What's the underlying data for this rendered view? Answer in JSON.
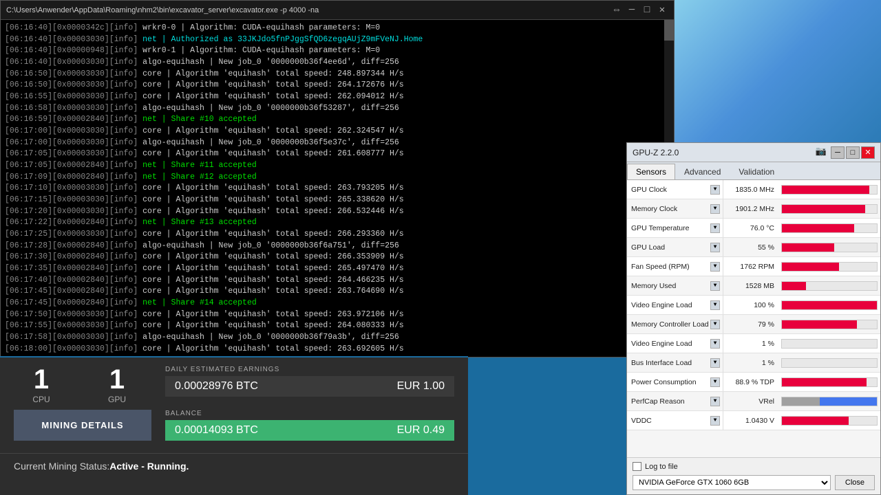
{
  "terminal": {
    "title": "C:\\Users\\Anwender\\AppData\\Roaming\\nhm2\\bin\\excavator_server\\excavator.exe  -p 4000 -na",
    "lines": [
      {
        "prefix": "[06:16:40][0x0000342c][info]",
        "text": " wrkr0-0 | Algorithm: CUDA-equihash parameters: M=0",
        "color": "normal"
      },
      {
        "prefix": "[06:16:40][0x00003030][info]",
        "text": " net | Authorized as 33JKJdo5fnPJggSfQD6zegqAUjZ9mFVeNJ.Home",
        "color": "cyan"
      },
      {
        "prefix": "[06:16:40][0x00000948][info]",
        "text": " wrkr0-1 | Algorithm: CUDA-equihash parameters: M=0",
        "color": "normal"
      },
      {
        "prefix": "[06:16:40][0x00003030][info]",
        "text": " algo-equihash | New job_0 '0000000b36f4ee6d', diff=256",
        "color": "normal"
      },
      {
        "prefix": "[06:16:50][0x00003030][info]",
        "text": " core | Algorithm 'equihash' total speed: 248.897344 H/s",
        "color": "normal"
      },
      {
        "prefix": "[06:16:50][0x00003030][info]",
        "text": " core | Algorithm 'equihash' total speed: 264.172676 H/s",
        "color": "normal"
      },
      {
        "prefix": "[06:16:55][0x00003030][info]",
        "text": " core | Algorithm 'equihash' total speed: 262.094012 H/s",
        "color": "normal"
      },
      {
        "prefix": "[06:16:58][0x00003030][info]",
        "text": " algo-equihash | New job_0 '0000000b36f53287', diff=256",
        "color": "normal"
      },
      {
        "prefix": "[06:16:59][0x00002840][info]",
        "text": " net | Share #10 accepted",
        "color": "green"
      },
      {
        "prefix": "[06:17:00][0x00003030][info]",
        "text": " core | Algorithm 'equihash' total speed: 262.324547 H/s",
        "color": "normal"
      },
      {
        "prefix": "[06:17:00][0x00003030][info]",
        "text": " algo-equihash | New job_0 '0000000b36f5e37c', diff=256",
        "color": "normal"
      },
      {
        "prefix": "[06:17:05][0x00003030][info]",
        "text": " core | Algorithm 'equihash' total speed: 261.608777 H/s",
        "color": "normal"
      },
      {
        "prefix": "[06:17:05][0x00002840][info]",
        "text": " net | Share #11 accepted",
        "color": "green"
      },
      {
        "prefix": "[06:17:09][0x00002840][info]",
        "text": " net | Share #12 accepted",
        "color": "green"
      },
      {
        "prefix": "[06:17:10][0x00003030][info]",
        "text": " core | Algorithm 'equihash' total speed: 263.793205 H/s",
        "color": "normal"
      },
      {
        "prefix": "[06:17:15][0x00003030][info]",
        "text": " core | Algorithm 'equihash' total speed: 265.338620 H/s",
        "color": "normal"
      },
      {
        "prefix": "[06:17:20][0x00003030][info]",
        "text": " core | Algorithm 'equihash' total speed: 266.532446 H/s",
        "color": "normal"
      },
      {
        "prefix": "[06:17:22][0x00002840][info]",
        "text": " net | Share #13 accepted",
        "color": "green"
      },
      {
        "prefix": "[06:17:25][0x00003030][info]",
        "text": " core | Algorithm 'equihash' total speed: 266.293360 H/s",
        "color": "normal"
      },
      {
        "prefix": "[06:17:28][0x00002840][info]",
        "text": " algo-equihash | New job_0 '0000000b36f6a751', diff=256",
        "color": "normal"
      },
      {
        "prefix": "[06:17:30][0x00002840][info]",
        "text": " core | Algorithm 'equihash' total speed: 266.353909 H/s",
        "color": "normal"
      },
      {
        "prefix": "[06:17:35][0x00002840][info]",
        "text": " core | Algorithm 'equihash' total speed: 265.497470 H/s",
        "color": "normal"
      },
      {
        "prefix": "[06:17:40][0x00002840][info]",
        "text": " core | Algorithm 'equihash' total speed: 264.466235 H/s",
        "color": "normal"
      },
      {
        "prefix": "[06:17:45][0x00002840][info]",
        "text": " core | Algorithm 'equihash' total speed: 263.764690 H/s",
        "color": "normal"
      },
      {
        "prefix": "[06:17:45][0x00002840][info]",
        "text": " net | Share #14 accepted",
        "color": "green"
      },
      {
        "prefix": "[06:17:50][0x00003030][info]",
        "text": " core | Algorithm 'equihash' total speed: 263.972106 H/s",
        "color": "normal"
      },
      {
        "prefix": "[06:17:55][0x00003030][info]",
        "text": " core | Algorithm 'equihash' total speed: 264.080333 H/s",
        "color": "normal"
      },
      {
        "prefix": "[06:17:58][0x00003030][info]",
        "text": " algo-equihash | New job_0 '0000000b36f79a3b', diff=256",
        "color": "normal"
      },
      {
        "prefix": "[06:18:00][0x00003030][info]",
        "text": " core | Algorithm 'equihash' total speed: 263.692605 H/s",
        "color": "normal"
      }
    ]
  },
  "mining": {
    "cpu_count": "1",
    "cpu_label": "CPU",
    "gpu_count": "1",
    "gpu_label": "GPU",
    "earnings_label": "DAILY ESTIMATED EARNINGS",
    "earnings_btc": "0.00028976 BTC",
    "earnings_eur": "EUR 1.00",
    "mining_details_btn": "MINING DETAILS",
    "balance_label": "BALANCE",
    "balance_btc": "0.00014093 BTC",
    "balance_eur": "EUR 0.49",
    "status_prefix": "Current Mining Status: ",
    "status_value": "Active - Running."
  },
  "gpuz": {
    "title": "GPU-Z 2.2.0",
    "tabs": [
      "Sensors",
      "Advanced",
      "Validation"
    ],
    "active_tab": "Sensors",
    "sensors": [
      {
        "name": "GPU Clock",
        "value": "1835.0 MHz",
        "fill_pct": 92,
        "fill_color": "#e8003c"
      },
      {
        "name": "Memory Clock",
        "value": "1901.2 MHz",
        "fill_pct": 88,
        "fill_color": "#e8003c"
      },
      {
        "name": "GPU Temperature",
        "value": "76.0 °C",
        "fill_pct": 76,
        "fill_color": "#e8003c"
      },
      {
        "name": "GPU Load",
        "value": "55 %",
        "fill_pct": 55,
        "fill_color": "#e8003c"
      },
      {
        "name": "Fan Speed (RPM)",
        "value": "1762 RPM",
        "fill_pct": 60,
        "fill_color": "#e8003c"
      },
      {
        "name": "Memory Used",
        "value": "1528 MB",
        "fill_pct": 25,
        "fill_color": "#e8003c"
      },
      {
        "name": "Video Engine Load",
        "value": "100 %",
        "fill_pct": 100,
        "fill_color": "#e8003c"
      },
      {
        "name": "Memory Controller Load",
        "value": "79 %",
        "fill_pct": 79,
        "fill_color": "#e8003c"
      },
      {
        "name": "Video Engine Load",
        "value": "1 %",
        "fill_pct": 2,
        "fill_color": "#e8e8e8"
      },
      {
        "name": "Bus Interface Load",
        "value": "1 %",
        "fill_pct": 2,
        "fill_color": "#e8e8e8"
      },
      {
        "name": "Power Consumption",
        "value": "88.9 % TDP",
        "fill_pct": 89,
        "fill_color": "#e8003c"
      },
      {
        "name": "PerfCap Reason",
        "value": "VRel",
        "fill_pct_left": 40,
        "fill_left_color": "#a0a0a0",
        "fill_pct_right": 60,
        "fill_right_color": "#4477ee",
        "special": true
      },
      {
        "name": "VDDC",
        "value": "1.0430 V",
        "fill_pct": 70,
        "fill_color": "#e8003c"
      }
    ],
    "log_to_file": "Log to file",
    "gpu_name": "NVIDIA GeForce GTX 1060 6GB",
    "close_btn": "Close"
  }
}
